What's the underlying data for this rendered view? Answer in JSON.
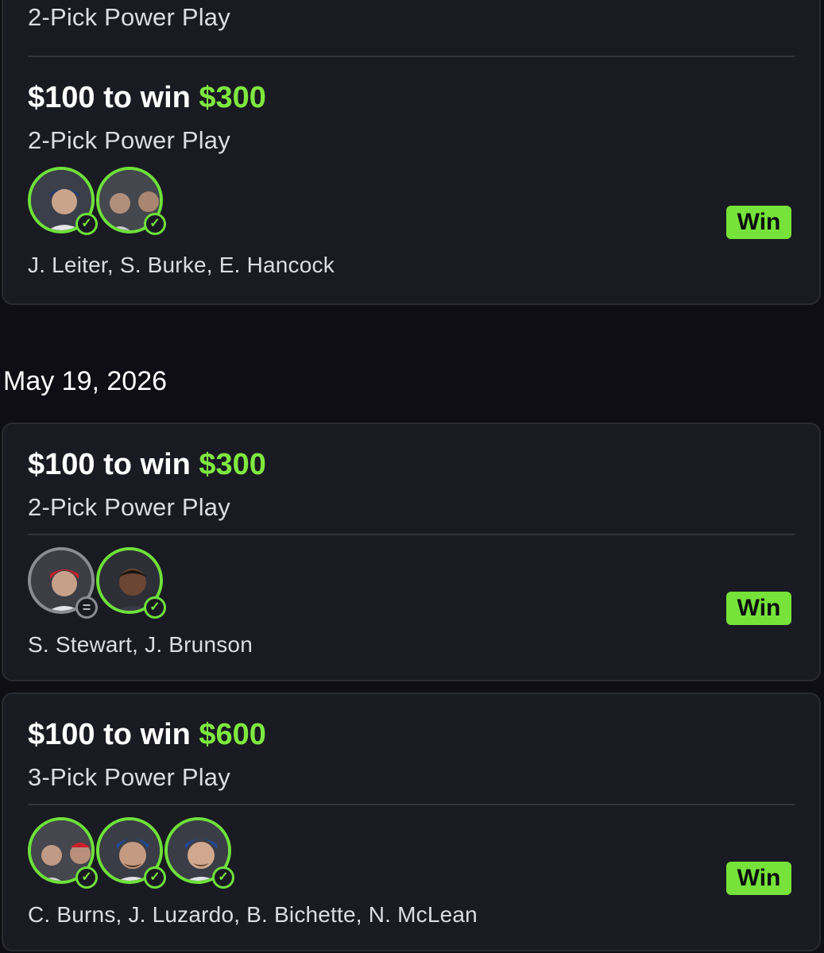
{
  "top_card": {
    "play_type_header": "2-Pick Power Play",
    "amount_text": "$100 to win ",
    "win_amount": "$300",
    "play_type": "2-Pick Power Play",
    "players": "J. Leiter, S. Burke, E. Hancock",
    "result": "Win",
    "avatars": [
      {
        "icon": "player-avatar",
        "status": "check"
      },
      {
        "icon": "player-avatar",
        "status": "check"
      }
    ]
  },
  "date_header": "May 19, 2026",
  "entries": [
    {
      "amount_text": "$100 to win ",
      "win_amount": "$300",
      "play_type": "2-Pick Power Play",
      "players": "S. Stewart, J. Brunson",
      "result": "Win",
      "avatars": [
        {
          "icon": "player-avatar",
          "status": "push"
        },
        {
          "icon": "player-avatar",
          "status": "check"
        }
      ]
    },
    {
      "amount_text": "$100 to win ",
      "win_amount": "$600",
      "play_type": "3-Pick Power Play",
      "players": "C. Burns, J. Luzardo, B. Bichette, N. McLean",
      "result": "Win",
      "avatars": [
        {
          "icon": "player-avatar",
          "status": "check"
        },
        {
          "icon": "player-avatar",
          "status": "check"
        },
        {
          "icon": "player-avatar",
          "status": "check"
        }
      ]
    }
  ],
  "colors": {
    "background": "#0e0e14",
    "card": "#1a1a22",
    "accent_green": "#7ee83f",
    "badge_green": "#76e23a",
    "push_gray": "#8b8b93"
  },
  "status_icons": {
    "check": "✓",
    "push": "="
  }
}
